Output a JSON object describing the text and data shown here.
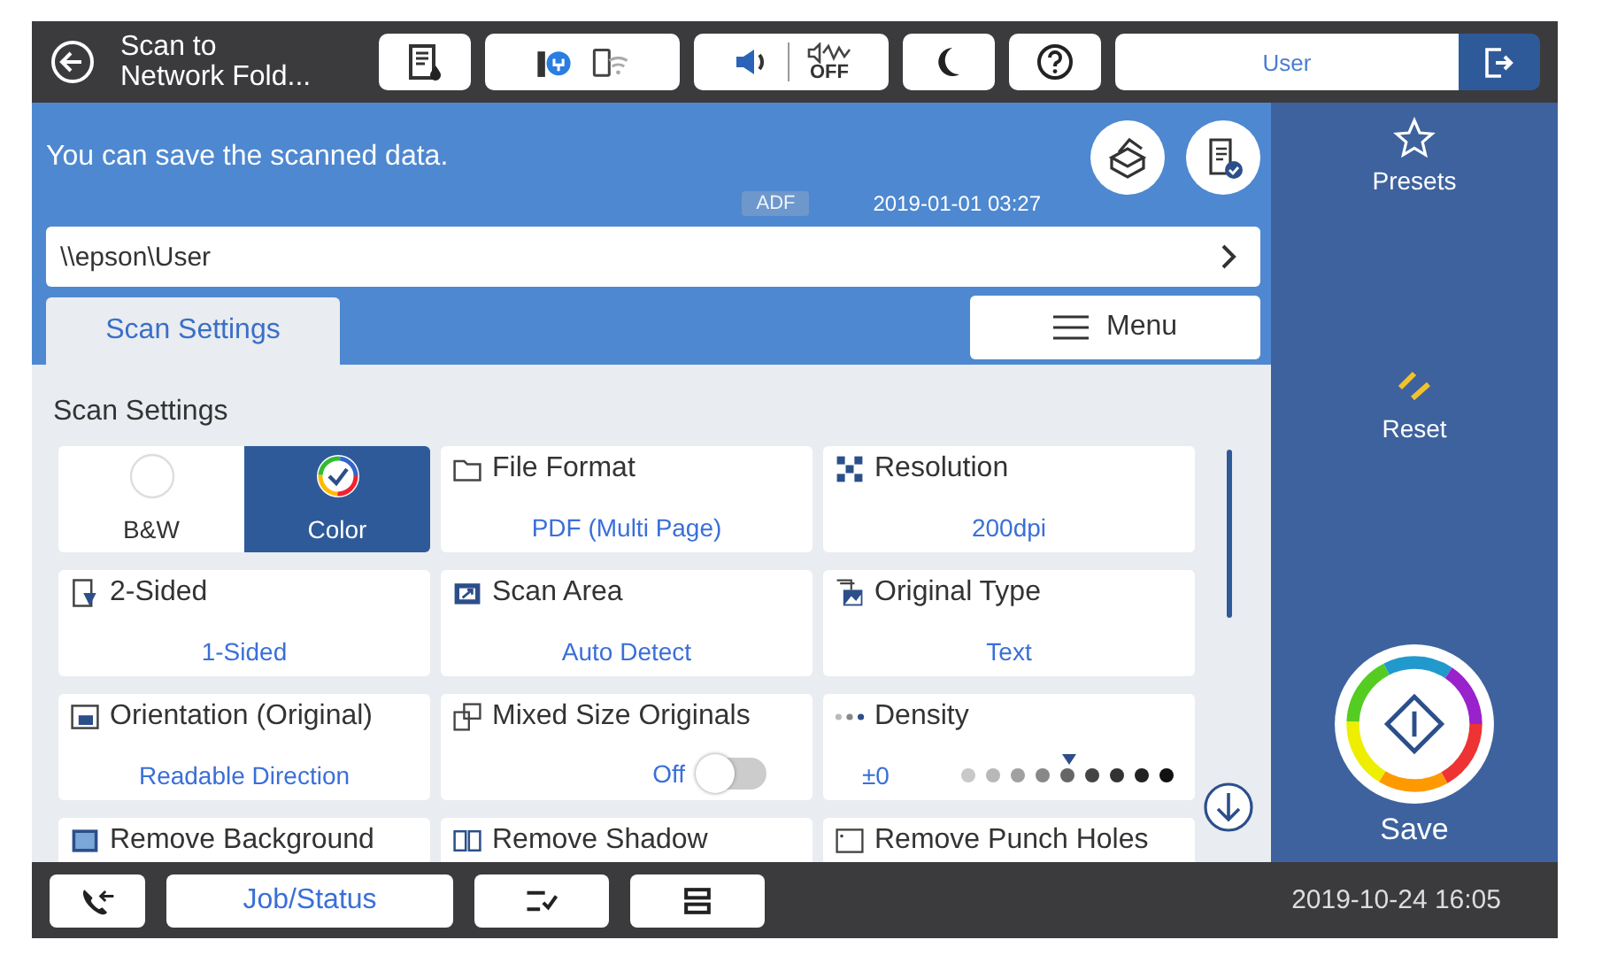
{
  "top_bar": {
    "title_lines": [
      "Scan to",
      "Network Fold..."
    ],
    "quiet_mode_label": "OFF",
    "user_field": {
      "value": "User"
    }
  },
  "header": {
    "message": "You can save the scanned data.",
    "source_badge": "ADF",
    "date_time": "2019-01-01 03:27"
  },
  "destination": {
    "path": "\\\\epson\\User"
  },
  "tabs": [
    {
      "label": "Scan Settings",
      "selected": true
    }
  ],
  "menu_button": "Menu",
  "section_title": "Scan Settings",
  "color_mode": [
    {
      "label": "B&W",
      "selected": false
    },
    {
      "label": "Color",
      "selected": true
    }
  ],
  "settings": [
    {
      "kind": "value",
      "label": "File Format",
      "value": "PDF (Multi Page)"
    },
    {
      "kind": "value",
      "label": "Resolution",
      "value": "200dpi"
    },
    {
      "kind": "value",
      "label": "2-Sided",
      "value": "1-Sided"
    },
    {
      "kind": "value",
      "label": "Scan Area",
      "value": "Auto Detect"
    },
    {
      "kind": "value",
      "label": "Original Type",
      "value": "Text"
    },
    {
      "kind": "value",
      "label": "Orientation (Original)",
      "value": "Readable Direction"
    },
    {
      "kind": "toggle",
      "label": "Mixed Size Originals",
      "value": "Off",
      "on": false
    },
    {
      "kind": "scale",
      "label": "Density",
      "value": "±0",
      "level": 0.5
    },
    {
      "kind": "cut",
      "label": "Remove Background"
    },
    {
      "kind": "cut",
      "label": "Remove Shadow"
    },
    {
      "kind": "cut",
      "label": "Remove Punch Holes"
    }
  ],
  "sidebar": {
    "presets": "Presets",
    "reset": "Reset",
    "save": "Save"
  },
  "bottom_bar": {
    "job_status": "Job/Status",
    "date_time": "2019-10-24 16:05"
  }
}
